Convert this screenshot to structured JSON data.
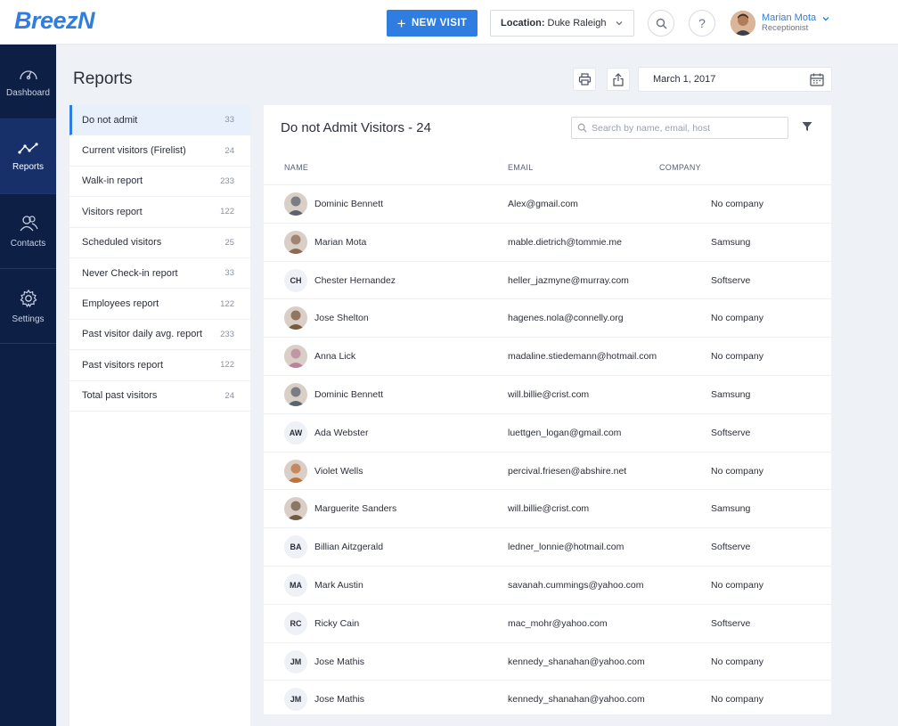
{
  "app": {
    "logo": "BreezN"
  },
  "topbar": {
    "new_visit_label": "NEW VISIT",
    "location_label": "Location:",
    "location_value": "Duke Raleigh",
    "help_label": "?",
    "user_name": "Marian Mota",
    "user_role": "Receptionist"
  },
  "sidebar": {
    "items": [
      {
        "label": "Dashboard",
        "icon": "gauge-icon"
      },
      {
        "label": "Reports",
        "icon": "chart-line-icon",
        "active": true
      },
      {
        "label": "Contacts",
        "icon": "contacts-icon"
      },
      {
        "label": "Settings",
        "icon": "gear-icon"
      }
    ]
  },
  "page": {
    "title": "Reports",
    "date": "March 1, 2017"
  },
  "reports": [
    {
      "label": "Do not admit",
      "count": "33",
      "active": true
    },
    {
      "label": "Current visitors  (Firelist)",
      "count": "24"
    },
    {
      "label": "Walk-in report",
      "count": "233"
    },
    {
      "label": "Visitors report",
      "count": "122"
    },
    {
      "label": "Scheduled visitors",
      "count": "25"
    },
    {
      "label": "Never Check-in report",
      "count": "33"
    },
    {
      "label": "Employees report",
      "count": "122"
    },
    {
      "label": "Past visitor daily avg. report",
      "count": "233"
    },
    {
      "label": "Past visitors report",
      "count": "122"
    },
    {
      "label": "Total past visitors",
      "count": "24"
    }
  ],
  "table": {
    "title": "Do not Admit Visitors - 24",
    "search_placeholder": "Search by name, email, host",
    "columns": {
      "name": "NAME",
      "email": "EMAIL",
      "company": "COMPANY"
    },
    "rows": [
      {
        "name": "Dominic Bennett",
        "email": "Alex@gmail.com",
        "company": "No company",
        "initials": "",
        "avatar_color": "#5b6270"
      },
      {
        "name": "Marian Mota",
        "email": "mable.dietrich@tommie.me",
        "company": "Samsung",
        "initials": "",
        "avatar_color": "#8d6a55"
      },
      {
        "name": "Chester Hernandez",
        "email": "heller_jazmyne@murray.com",
        "company": "Softserve",
        "initials": "CH",
        "avatar_color": ""
      },
      {
        "name": "Jose Shelton",
        "email": "hagenes.nola@connelly.org",
        "company": "No company",
        "initials": "",
        "avatar_color": "#7a5a3c"
      },
      {
        "name": "Anna Lick",
        "email": "madaline.stiedemann@hotmail.com",
        "company": "No company",
        "initials": "",
        "avatar_color": "#b9849a"
      },
      {
        "name": "Dominic Bennett",
        "email": "will.billie@crist.com",
        "company": "Samsung",
        "initials": "",
        "avatar_color": "#5b6270"
      },
      {
        "name": "Ada Webster",
        "email": "luettgen_logan@gmail.com",
        "company": "Softserve",
        "initials": "AW",
        "avatar_color": ""
      },
      {
        "name": "Violet Wells",
        "email": "percival.friesen@abshire.net",
        "company": "No company",
        "initials": "",
        "avatar_color": "#c2703a"
      },
      {
        "name": "Marguerite Sanders",
        "email": "will.billie@crist.com",
        "company": "Samsung",
        "initials": "",
        "avatar_color": "#6f5a44"
      },
      {
        "name": "Billian Aitzgerald",
        "email": "ledner_lonnie@hotmail.com",
        "company": "Softserve",
        "initials": "BA",
        "avatar_color": ""
      },
      {
        "name": "Mark Austin",
        "email": "savanah.cummings@yahoo.com",
        "company": "No company",
        "initials": "MA",
        "avatar_color": ""
      },
      {
        "name": "Ricky Cain",
        "email": "mac_mohr@yahoo.com",
        "company": "Softserve",
        "initials": "RC",
        "avatar_color": ""
      },
      {
        "name": "Jose Mathis",
        "email": "kennedy_shanahan@yahoo.com",
        "company": "No company",
        "initials": "JM",
        "avatar_color": ""
      },
      {
        "name": "Jose Mathis",
        "email": "kennedy_shanahan@yahoo.com",
        "company": "No company",
        "initials": "JM",
        "avatar_color": ""
      }
    ]
  },
  "colors": {
    "accent": "#2f7de1",
    "sidebar": "#0e1f45",
    "sidebar_active": "#17306a",
    "background": "#eef1f6"
  }
}
